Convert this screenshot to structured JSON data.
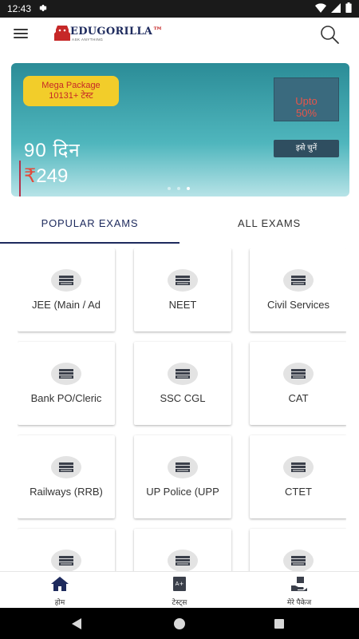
{
  "status_bar": {
    "time": "12:43",
    "icons": [
      "gear-icon",
      "wifi-icon",
      "signal-icon",
      "battery-icon"
    ]
  },
  "app_bar": {
    "logo_main": "EDUGORILLA",
    "logo_accent": "™",
    "logo_tagline": "ASK ANYTHING",
    "menu_icon": "menu-icon",
    "search_icon": "search-icon"
  },
  "banner": {
    "package_line1": "Mega Package",
    "package_line2": "10131+ टेस्ट",
    "upto_line1": "Upto",
    "upto_line2": "50%",
    "days": "90 दिन",
    "currency": "₹",
    "price": "249",
    "choose_label": "इसे चुनें",
    "page_count": 3,
    "active_page": 2
  },
  "tabs": [
    {
      "label": "POPULAR EXAMS",
      "active": true
    },
    {
      "label": "ALL EXAMS",
      "active": false
    }
  ],
  "exams": [
    {
      "label": "JEE (Main / Ad"
    },
    {
      "label": "NEET"
    },
    {
      "label": "Civil Services"
    },
    {
      "label": "Bank PO/Cleric"
    },
    {
      "label": "SSC CGL"
    },
    {
      "label": "CAT"
    },
    {
      "label": "Railways (RRB)"
    },
    {
      "label": "UP Police (UPP"
    },
    {
      "label": "CTET"
    },
    {
      "label": ""
    },
    {
      "label": ""
    },
    {
      "label": ""
    }
  ],
  "bottom_nav": [
    {
      "label": "होम",
      "icon": "home-icon"
    },
    {
      "label": "टेस्ट्स",
      "icon": "tests-icon"
    },
    {
      "label": "मेरे पैकेज",
      "icon": "package-icon"
    }
  ],
  "colors": {
    "brand_navy": "#1d2a5d",
    "brand_red": "#c62828",
    "badge_yellow": "#f2cd2a",
    "banner_teal": "#2b8c97"
  }
}
